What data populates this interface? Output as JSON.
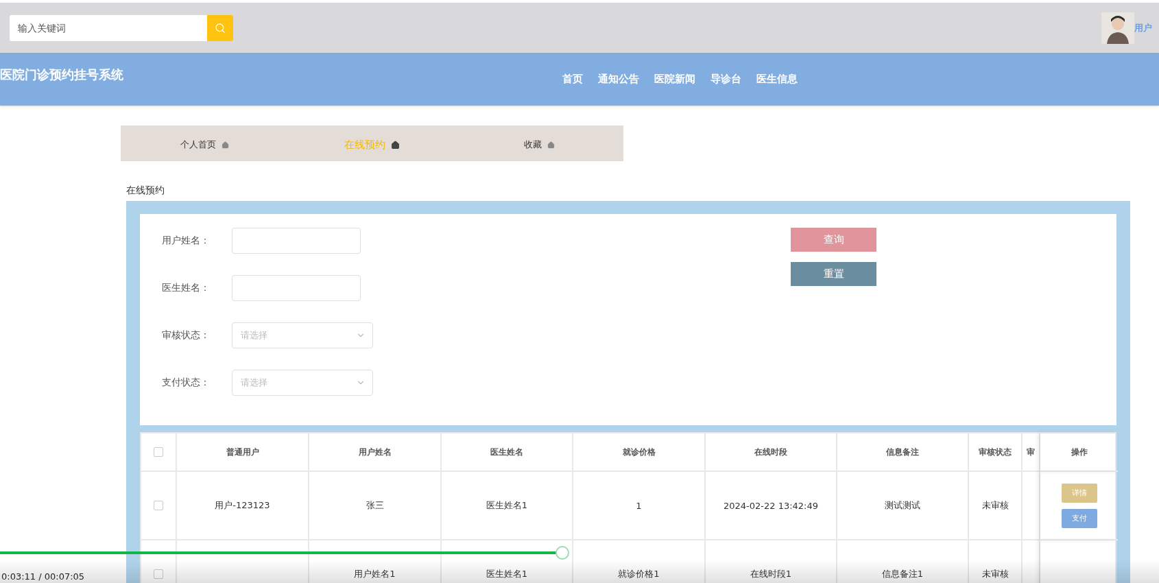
{
  "top_bar": {
    "search": {
      "placeholder": "输入关键词"
    },
    "user": {
      "label": "用户"
    }
  },
  "header": {
    "title": "医院门诊预约挂号系统",
    "nav": [
      {
        "label": "首页"
      },
      {
        "label": "通知公告"
      },
      {
        "label": "医院新闻"
      },
      {
        "label": "导诊台"
      },
      {
        "label": "医生信息"
      }
    ]
  },
  "tabs": [
    {
      "label": "个人首页",
      "selected": false
    },
    {
      "label": "在线预约",
      "selected": true
    },
    {
      "label": "收藏",
      "selected": false
    }
  ],
  "section_title": "在线预约",
  "filters": [
    {
      "kind": "text",
      "label": "用户姓名："
    },
    {
      "kind": "text",
      "label": "医生姓名："
    },
    {
      "kind": "select",
      "label": "审核状态：",
      "placeholder": "请选择"
    },
    {
      "kind": "select",
      "label": "支付状态：",
      "placeholder": "请选择"
    }
  ],
  "buttons": [
    {
      "kind": "query",
      "label": "查询"
    },
    {
      "kind": "reset",
      "label": "重置"
    }
  ],
  "table": {
    "header_checked": false,
    "columns": [
      "普通用户",
      "用户姓名",
      "医生姓名",
      "就诊价格",
      "在线时段",
      "信息备注",
      "审核状态",
      "审"
    ],
    "action_column": "操作",
    "rows": [
      {
        "checked": false,
        "cells": [
          "用户-123123",
          "张三",
          "医生姓名1",
          "1",
          "2024-02-22 13:42:49",
          "测试测试",
          "未审核",
          ""
        ],
        "actions": [
          {
            "kind": "detail",
            "label": "详情"
          },
          {
            "kind": "pay",
            "label": "支付"
          }
        ]
      },
      {
        "checked": false,
        "cells": [
          "",
          "用户姓名1",
          "医生姓名1",
          "就诊价格1",
          "在线时段1",
          "信息备注1",
          "未审核",
          ""
        ],
        "actions": []
      }
    ]
  },
  "video_player": {
    "progress": {
      "level": 0.485
    },
    "time": "0:03:11 / 00:07:05"
  }
}
